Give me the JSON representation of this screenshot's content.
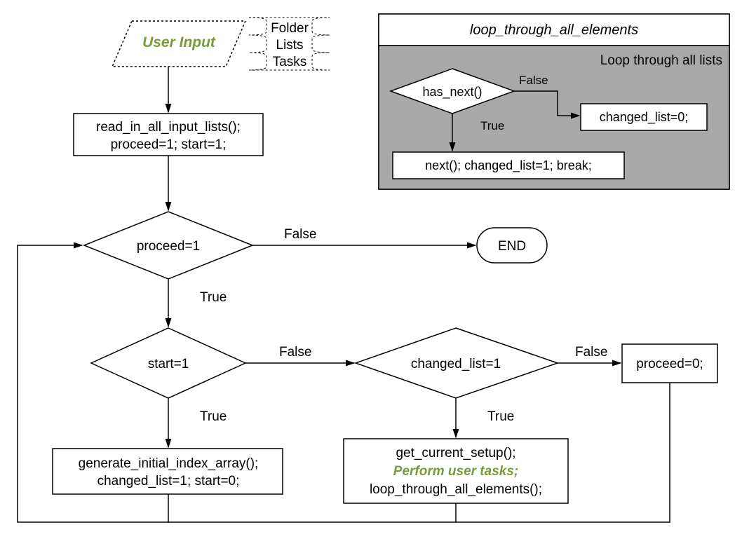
{
  "main": {
    "user_input_label": "User Input",
    "annotation_folder": "Folder",
    "annotation_lists": "Lists",
    "annotation_tasks": "Tasks",
    "read_in_line1": "read_in_all_input_lists();",
    "read_in_line2": "proceed=1; start=1;",
    "proceed_check": "proceed=1",
    "proceed_false": "False",
    "proceed_true": "True",
    "end_label": "END",
    "start_check": "start=1",
    "start_false": "False",
    "start_true": "True",
    "changed_check": "changed_list=1",
    "changed_false": "False",
    "changed_true": "True",
    "proceed_zero": "proceed=0;",
    "generate_line1": "generate_initial_index_array();",
    "generate_line2": "changed_list=1; start=0;",
    "getcurrent_line1": "get_current_setup();",
    "getcurrent_line2": "Perform user tasks;",
    "getcurrent_line3": "loop_through_all_elements();"
  },
  "sub": {
    "title": "loop_through_all_elements",
    "loop_label": "Loop through all lists",
    "has_next": "has_next()",
    "has_next_false": "False",
    "has_next_true": "True",
    "changed_zero": "changed_list=0;",
    "next_break": "next(); changed_list=1; break;"
  }
}
